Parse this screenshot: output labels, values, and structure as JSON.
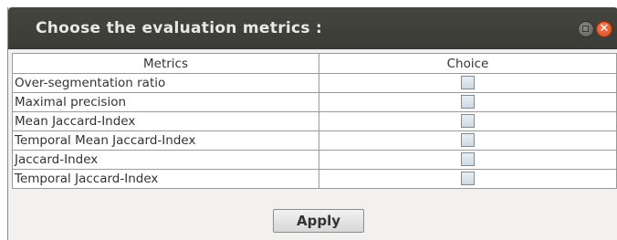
{
  "window": {
    "title": "Choose the evaluation metrics :",
    "close_glyph": "✕"
  },
  "table": {
    "headers": [
      "Metrics",
      "Choice"
    ],
    "rows": [
      {
        "metric": "Over-segmentation ratio",
        "checked": false
      },
      {
        "metric": "Maximal precision",
        "checked": false
      },
      {
        "metric": "Mean Jaccard-Index",
        "checked": false
      },
      {
        "metric": "Temporal Mean Jaccard-Index",
        "checked": false
      },
      {
        "metric": "Jaccard-Index",
        "checked": false
      },
      {
        "metric": "Temporal Jaccard-Index",
        "checked": false
      }
    ]
  },
  "footer": {
    "apply_label": "Apply"
  }
}
